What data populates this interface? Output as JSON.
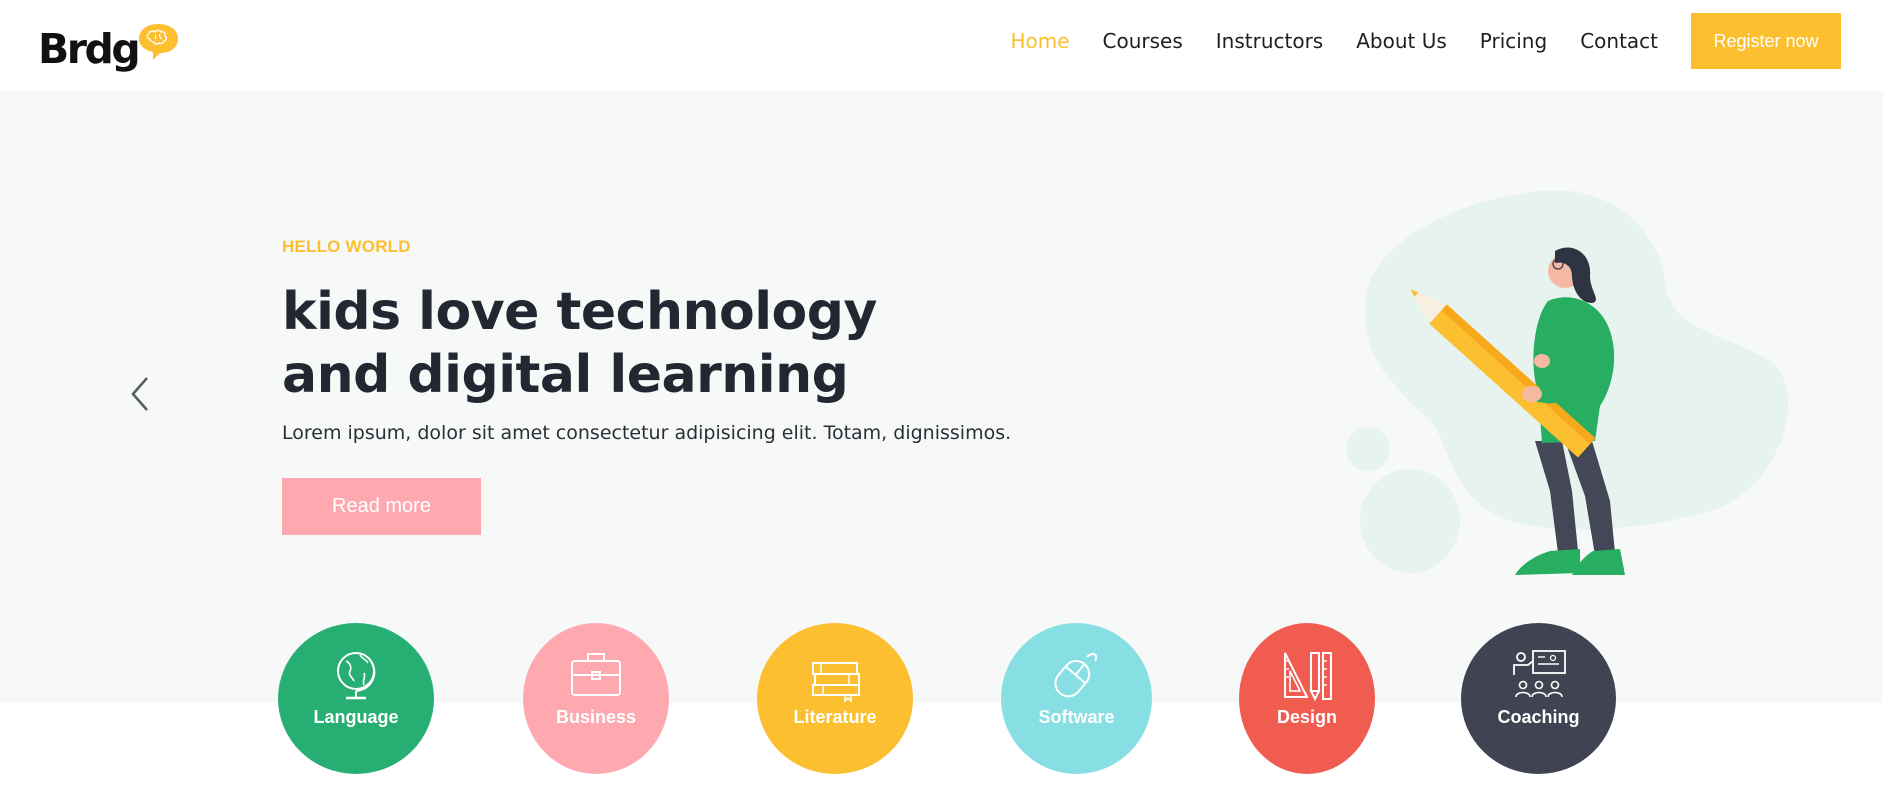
{
  "header": {
    "logo_text": "Brdg",
    "nav": [
      {
        "label": "Home",
        "active": true
      },
      {
        "label": "Courses",
        "active": false
      },
      {
        "label": "Instructors",
        "active": false
      },
      {
        "label": "About Us",
        "active": false
      },
      {
        "label": "Pricing",
        "active": false
      },
      {
        "label": "Contact",
        "active": false
      }
    ],
    "register_label": "Register now"
  },
  "hero": {
    "eyebrow": "HELLO WORLD",
    "title": "kids love technology and digital learning",
    "text": "Lorem ipsum, dolor sit amet consectetur adipisicing elit. Totam, dignissimos.",
    "cta_label": "Read more",
    "prev_icon": "chevron-left-icon",
    "next_icon": "chevron-right-icon"
  },
  "categories": [
    {
      "label": "Language",
      "icon": "globe-icon",
      "color": "#27ae73"
    },
    {
      "label": "Business",
      "icon": "briefcase-icon",
      "color": "#fda9af"
    },
    {
      "label": "Literature",
      "icon": "books-icon",
      "color": "#fcbf30"
    },
    {
      "label": "Software",
      "icon": "mouse-icon",
      "color": "#88dfe3"
    },
    {
      "label": "Design",
      "icon": "ruler-pencil-icon",
      "color": "#f15c51"
    },
    {
      "label": "Coaching",
      "icon": "classroom-icon",
      "color": "#404452"
    }
  ],
  "colors": {
    "accent": "#fcbf30",
    "cta": "#fda9af",
    "hero_bg": "#f7f9f8",
    "text_dark": "#222831"
  }
}
